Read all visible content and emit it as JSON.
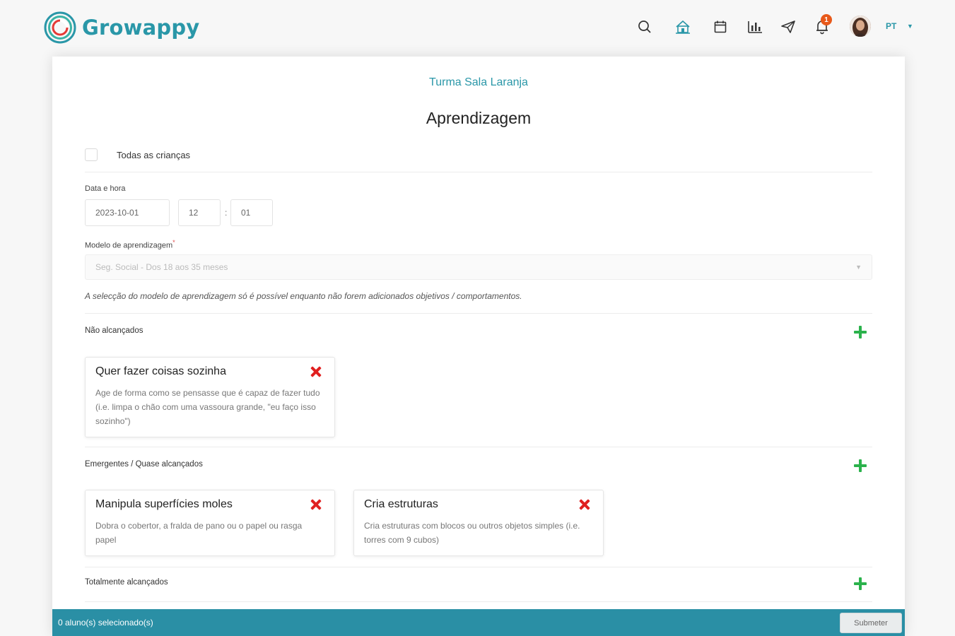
{
  "header": {
    "logo_text": "Growappy",
    "nav_icons": [
      "search-icon",
      "home-icon",
      "calendar-icon",
      "chart-icon",
      "send-icon",
      "bell-icon"
    ],
    "notification_count": "1",
    "language": "PT",
    "colors": {
      "brand": "#2a97a8",
      "badge": "#e8591a"
    }
  },
  "card": {
    "class_name": "Turma Sala Laranja",
    "title": "Aprendizagem",
    "all_children_label": "Todas as crianças",
    "datetime": {
      "label": "Data e hora",
      "date": "2023-10-01",
      "hour": "12",
      "separator": ":",
      "minute": "01"
    },
    "model": {
      "label": "Modelo de aprendizagem",
      "required_mark": "*",
      "selected": "Seg. Social - Dos 18 aos 35 meses"
    },
    "note": "A selecção do modelo de aprendizagem só é possível enquanto não forem adicionados objetivos / comportamentos.",
    "sections": [
      {
        "label": "Não alcançados",
        "items": [
          {
            "title": "Quer fazer coisas sozinha",
            "description": "Age de forma como se pensasse que é capaz de fazer tudo (i.e. limpa o chão com uma vassoura grande, \"eu faço isso sozinho\")"
          }
        ]
      },
      {
        "label": "Emergentes / Quase alcançados",
        "items": [
          {
            "title": "Manipula superfícies moles",
            "description": "Dobra o cobertor, a fralda de pano ou o papel ou rasga papel"
          },
          {
            "title": "Cria estruturas",
            "description": "Cria estruturas com blocos ou outros objetos simples (i.e. torres com 9 cubos)"
          }
        ]
      },
      {
        "label": "Totalmente alcançados",
        "items": []
      }
    ]
  },
  "footer": {
    "status": "0 aluno(s) selecionado(s)",
    "submit_label": "Submeter",
    "color": "#2a8fa5"
  }
}
